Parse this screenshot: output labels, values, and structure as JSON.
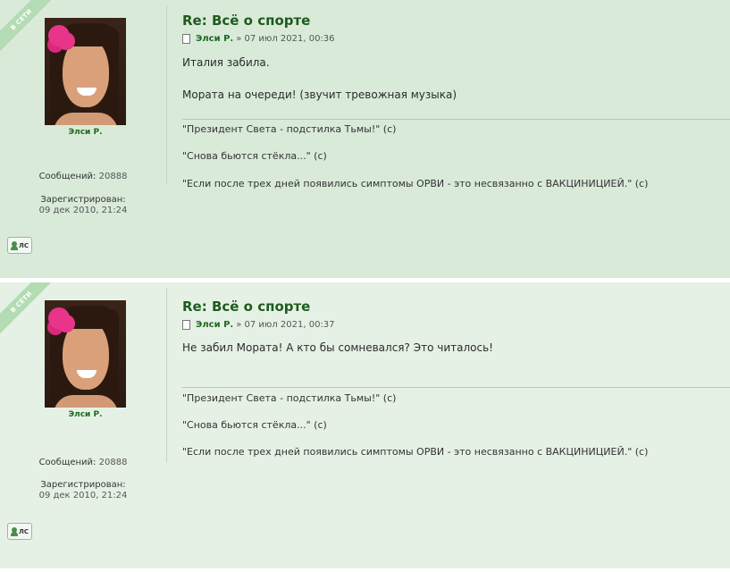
{
  "posts": [
    {
      "online_label": "В СЕТИ",
      "username": "Элси Р.",
      "posts_label": "Сообщений:",
      "posts_count": "20888",
      "registered_label": "Зарегистрирован:",
      "registered_date": "09 дек 2010, 21:24",
      "pm_label": "ЛС",
      "title": "Re: Всё о спорте",
      "author": "Элси Р.",
      "date": "» 07 июл 2021, 00:36",
      "message_lines": [
        "Италия забила.",
        "Мората на очереди! (звучит тревожная музыка)"
      ],
      "signature": [
        "\"Президент Света - подстилка Тьмы!\" (с)",
        "\"Снова бьются стёкла...\" (с)",
        "\"Если после трех дней появились симптомы ОРВИ - это несвязанно с ВАКЦИНИЦИЕЙ.\" (с)"
      ]
    },
    {
      "online_label": "В СЕТИ",
      "username": "Элси Р.",
      "posts_label": "Сообщений:",
      "posts_count": "20888",
      "registered_label": "Зарегистрирован:",
      "registered_date": "09 дек 2010, 21:24",
      "pm_label": "ЛС",
      "title": "Re: Всё о спорте",
      "author": "Элси Р.",
      "date": "» 07 июл 2021, 00:37",
      "message_lines": [
        "Не забил Мората! А кто бы сомневался? Это читалось!"
      ],
      "signature": [
        "\"Президент Света - подстилка Тьмы!\" (с)",
        "\"Снова бьются стёкла...\" (с)",
        "\"Если после трех дней появились симптомы ОРВИ - это несвязанно с ВАКЦИНИЦИЕЙ.\" (с)"
      ]
    }
  ],
  "icons": {
    "post_icon": "document-icon",
    "pm_icon": "person-icon"
  },
  "colors": {
    "post1_bg": "#d9ead9",
    "post2_bg": "#e6f1e6",
    "title": "#1e5b1e",
    "username": "#1e6b1e"
  }
}
